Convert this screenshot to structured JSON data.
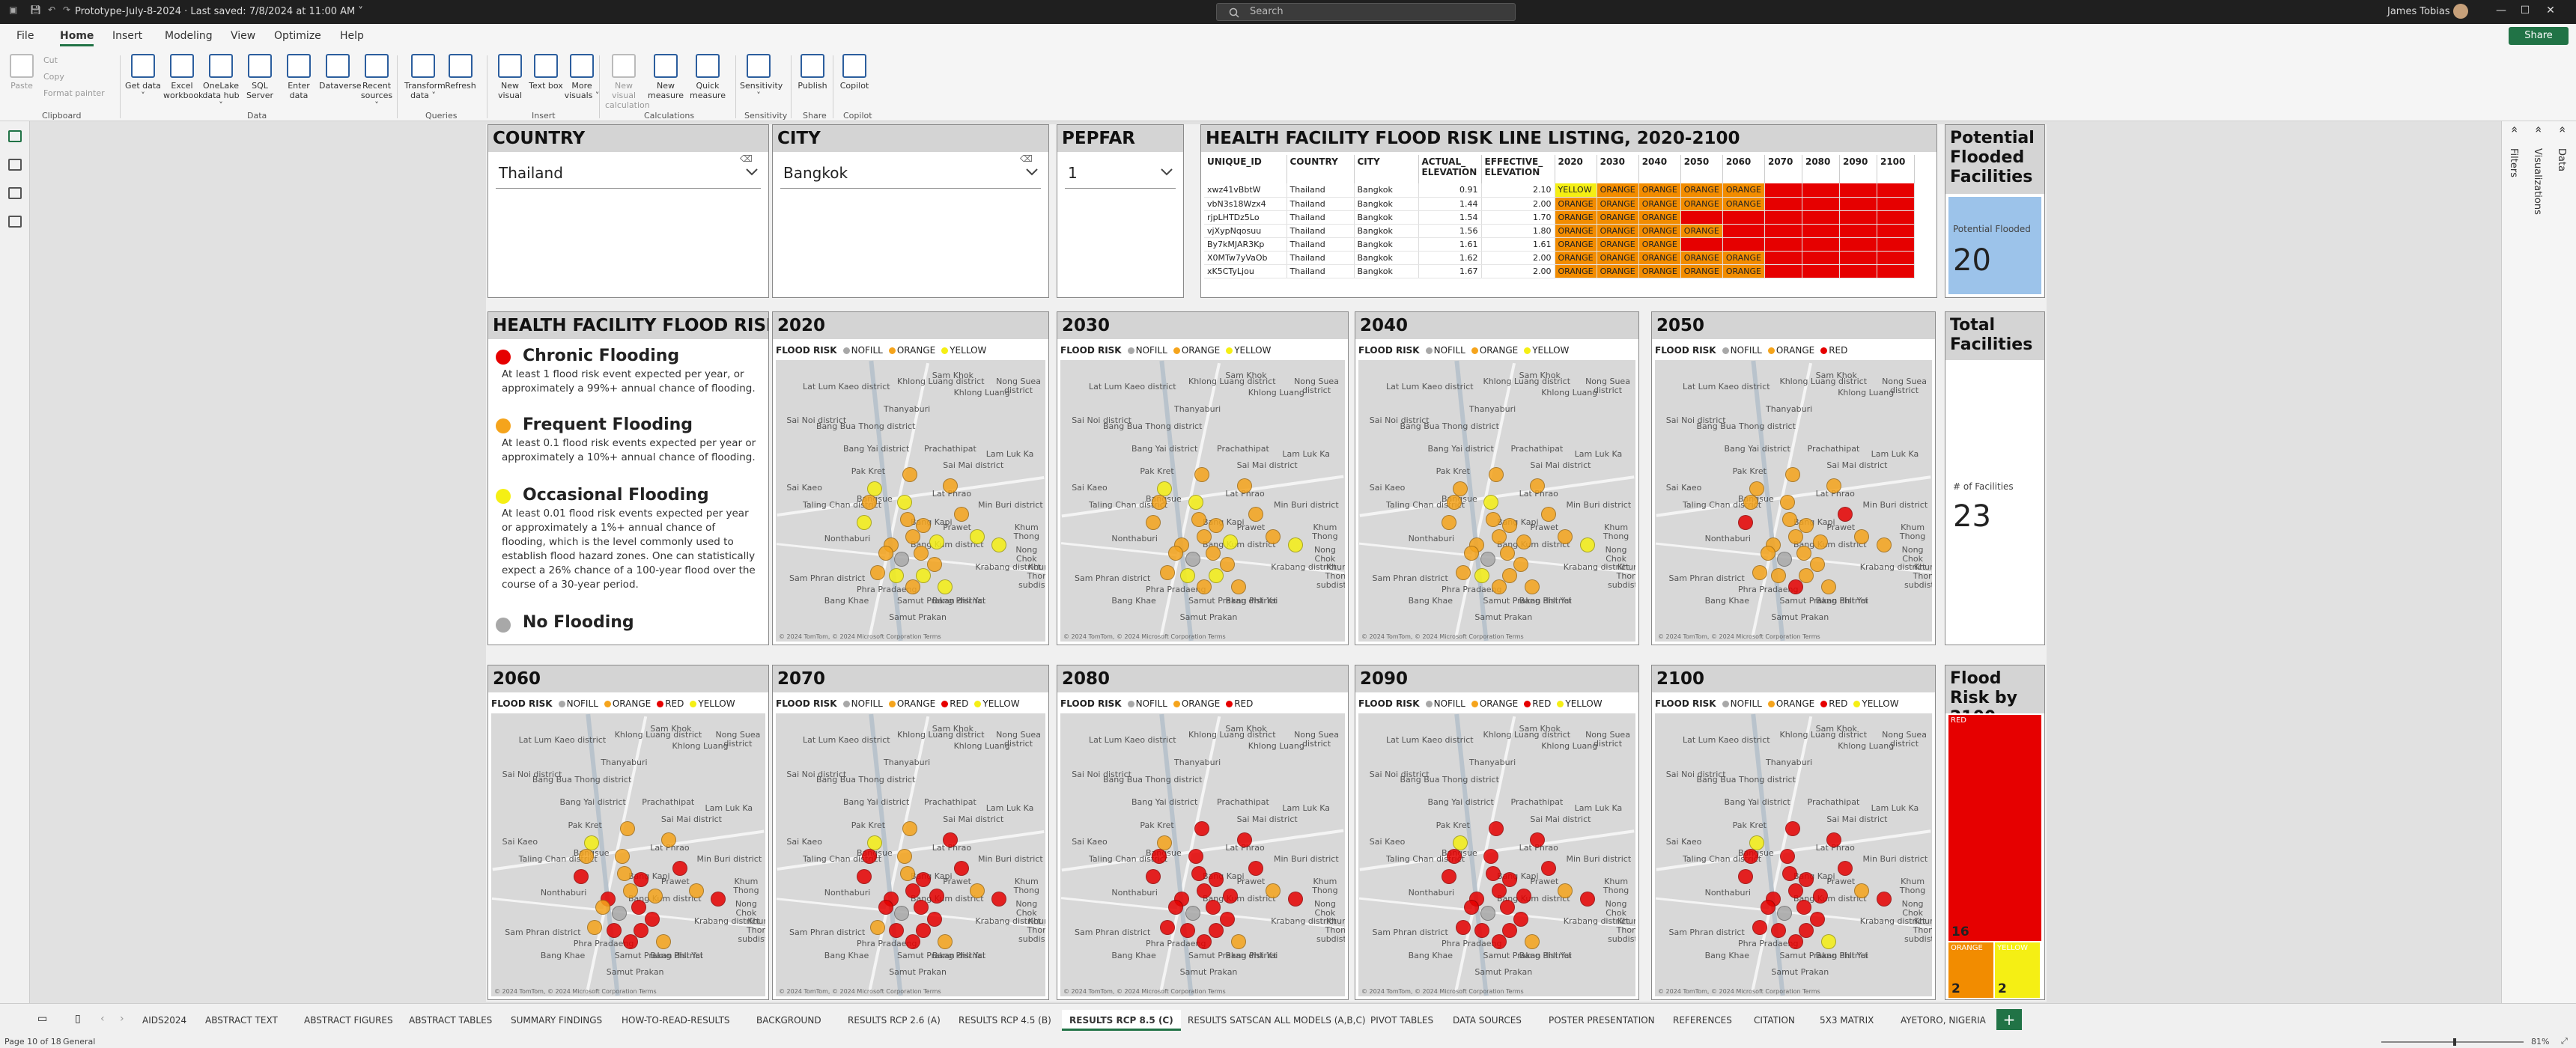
{
  "window": {
    "doc_title": "Prototype-July-8-2024 · Last saved: 7/8/2024 at 11:00 AM ˅",
    "search_placeholder": "Search",
    "user_name": "James Tobias"
  },
  "menu": {
    "tabs": [
      "File",
      "Home",
      "Insert",
      "Modeling",
      "View",
      "Optimize",
      "Help"
    ],
    "active": "Home",
    "share_label": "Share"
  },
  "ribbon": {
    "clipboard": {
      "paste": "Paste",
      "cut": "Cut",
      "copy": "Copy",
      "format_painter": "Format painter",
      "group": "Clipboard"
    },
    "data": {
      "buttons": [
        "Get data ˅",
        "Excel workbook",
        "OneLake data hub ˅",
        "SQL Server",
        "Enter data",
        "Dataverse",
        "Recent sources ˅"
      ],
      "group": "Data"
    },
    "queries": {
      "buttons": [
        "Transform data ˅",
        "Refresh"
      ],
      "group": "Queries"
    },
    "insert": {
      "buttons": [
        "New visual",
        "Text box",
        "More visuals ˅"
      ],
      "group": "Insert"
    },
    "calculations": {
      "buttons": [
        "New visual calculation",
        "New measure",
        "Quick measure"
      ],
      "group": "Calculations"
    },
    "sensitivity": {
      "buttons": [
        "Sensitivity ˅"
      ],
      "group": "Sensitivity"
    },
    "share": {
      "buttons": [
        "Publish"
      ],
      "group": "Share"
    },
    "copilot": {
      "buttons": [
        "Copilot"
      ],
      "group": "Copilot"
    }
  },
  "panes": {
    "filters": "Filters",
    "visualizations": "Visualizations",
    "data": "Data"
  },
  "slicers": {
    "country": {
      "title": "COUNTRY",
      "value": "Thailand"
    },
    "city": {
      "title": "CITY",
      "value": "Bangkok"
    },
    "pepfar": {
      "title": "PEPFAR",
      "value": "1"
    }
  },
  "listing": {
    "title": "HEALTH FACILITY FLOOD RISK LINE LISTING, 2020-2100",
    "columns": [
      "UNIQUE_ID",
      "COUNTRY",
      "CITY",
      "ACTUAL_ ELEVATION",
      "EFFECTIVE_ ELEVATION",
      "2020",
      "2030",
      "2040",
      "2050",
      "2060",
      "2070",
      "2080",
      "2090",
      "2100"
    ],
    "rows": [
      [
        "xwz41vBbtW",
        "Thailand",
        "Bangkok",
        "0.91",
        "2.10",
        "YELLOW",
        "ORANGE",
        "ORANGE",
        "ORANGE",
        "ORANGE",
        "RED",
        "RED",
        "RED",
        "RED"
      ],
      [
        "vbN3s18Wzx4",
        "Thailand",
        "Bangkok",
        "1.44",
        "2.00",
        "ORANGE",
        "ORANGE",
        "ORANGE",
        "ORANGE",
        "ORANGE",
        "RED",
        "RED",
        "RED",
        "RED"
      ],
      [
        "rjpLHTDz5Lo",
        "Thailand",
        "Bangkok",
        "1.54",
        "1.70",
        "ORANGE",
        "ORANGE",
        "ORANGE",
        "RED",
        "RED",
        "RED",
        "RED",
        "RED",
        "RED"
      ],
      [
        "vjXypNqosuu",
        "Thailand",
        "Bangkok",
        "1.56",
        "1.80",
        "ORANGE",
        "ORANGE",
        "ORANGE",
        "ORANGE",
        "RED",
        "RED",
        "RED",
        "RED",
        "RED"
      ],
      [
        "By7kMJAR3Kp",
        "Thailand",
        "Bangkok",
        "1.61",
        "1.61",
        "ORANGE",
        "ORANGE",
        "ORANGE",
        "RED",
        "RED",
        "RED",
        "RED",
        "RED",
        "RED"
      ],
      [
        "X0MTw7yVaOb",
        "Thailand",
        "Bangkok",
        "1.62",
        "2.00",
        "ORANGE",
        "ORANGE",
        "ORANGE",
        "ORANGE",
        "ORANGE",
        "RED",
        "RED",
        "RED",
        "RED"
      ],
      [
        "xK5CTyLjou",
        "Thailand",
        "Bangkok",
        "1.67",
        "2.00",
        "ORANGE",
        "ORANGE",
        "ORANGE",
        "ORANGE",
        "ORANGE",
        "RED",
        "RED",
        "RED",
        "RED"
      ]
    ]
  },
  "kpi_potential": {
    "title": "Potential Flooded Facilities ...",
    "label": "Potential Flooded",
    "value": "20"
  },
  "kpi_total": {
    "title": "Total Facilities",
    "label": "# of Facilities",
    "value": "23"
  },
  "flood_legend": {
    "title": "HEALTH FACILITY FLOOD RISK",
    "entries": [
      {
        "label": "Chronic Flooding",
        "color": "#e60000",
        "desc": "At least 1 flood risk event expected per year, or approximately a 99%+ annual chance of flooding."
      },
      {
        "label": "Frequent Flooding",
        "color": "#f5a41c",
        "desc": "At least 0.1 flood risk events expected per year or approximately a 10%+ annual chance of flooding."
      },
      {
        "label": "Occasional Flooding",
        "color": "#f5ef14",
        "desc": "At least 0.01 flood risk events expected per year or approximately a 1%+ annual chance of flooding, which is the level commonly used to establish flood hazard zones. One can statistically expect a 26% chance of a 100-year flood over the course of a 30-year period."
      },
      {
        "label": "No Flooding",
        "color": "#a8a8a8",
        "desc": ""
      }
    ]
  },
  "map_places": [
    "Lat Lum Kaeo district",
    "Khlong Luang district",
    "Nong Suea district",
    "Sai Noi district",
    "Thanyaburi",
    "Bang Bua Thong district",
    "Pak Kret",
    "Prachathipat",
    "Lam Luk Ka",
    "Sai Mai district",
    "Min Buri district",
    "Taling Chan district",
    "Bangsue",
    "Bang Kapi",
    "Khum Thong",
    "Nong Chok",
    "Sam Phran district",
    "Bang Phli Yai",
    "Samut Prakan",
    "Krabang district",
    "Khum Thong subdistrict",
    "Sam Khok",
    "Bang Yai district",
    "Sai Kaeo",
    "Samut Prakan district",
    "Khlong Luang",
    "Nonthaburi",
    "Bang Khae",
    "Phra Pradaeng",
    "Bang Kum district",
    "Prawet",
    "Lat Phrao"
  ],
  "map_attribution": "© 2024 TomTom, © 2024 Microsoft Corporation  Terms",
  "maps": [
    {
      "year": "2020",
      "legend": [
        {
          "label": "NOFILL",
          "color": "#a8a8a8"
        },
        {
          "label": "ORANGE",
          "color": "#f5a41c"
        },
        {
          "label": "YELLOW",
          "color": "#f5ef14"
        }
      ],
      "dots": [
        "#f5a41c",
        "#f5a41c",
        "#f5ef14",
        "#f5a41c",
        "#f5a41c",
        "#f5ef14",
        "#f5ef14",
        "#f5a41c",
        "#f5ef14",
        "#f5a41c",
        "#f5ef14",
        "#f5a41c",
        "#f5a41c",
        "#a8a8a8",
        "#f5a41c",
        "#f5a41c",
        "#f5ef14",
        "#f5a41c",
        "#f5ef14",
        "#f5ef14",
        "#f5a41c",
        "#f5ef14",
        "#f5a41c"
      ]
    },
    {
      "year": "2030",
      "legend": [
        {
          "label": "NOFILL",
          "color": "#a8a8a8"
        },
        {
          "label": "ORANGE",
          "color": "#f5a41c"
        },
        {
          "label": "YELLOW",
          "color": "#f5ef14"
        }
      ],
      "dots": [
        "#f5a41c",
        "#f5a41c",
        "#f5ef14",
        "#f5a41c",
        "#f5a41c",
        "#f5a41c",
        "#f5ef14",
        "#f5a41c",
        "#f5ef14",
        "#f5a41c",
        "#f5a41c",
        "#f5a41c",
        "#f5a41c",
        "#a8a8a8",
        "#f5a41c",
        "#f5a41c",
        "#f5ef14",
        "#f5a41c",
        "#f5a41c",
        "#f5ef14",
        "#f5a41c",
        "#f5ef14",
        "#f5a41c"
      ]
    },
    {
      "year": "2040",
      "legend": [
        {
          "label": "NOFILL",
          "color": "#a8a8a8"
        },
        {
          "label": "ORANGE",
          "color": "#f5a41c"
        },
        {
          "label": "YELLOW",
          "color": "#f5ef14"
        }
      ],
      "dots": [
        "#f5a41c",
        "#f5a41c",
        "#f5a41c",
        "#f5a41c",
        "#f5a41c",
        "#f5a41c",
        "#f5ef14",
        "#f5a41c",
        "#f5a41c",
        "#f5a41c",
        "#f5a41c",
        "#f5a41c",
        "#f5a41c",
        "#a8a8a8",
        "#f5a41c",
        "#f5a41c",
        "#f5ef14",
        "#f5a41c",
        "#f5a41c",
        "#f5ef14",
        "#f5a41c",
        "#f5a41c",
        "#f5a41c"
      ]
    },
    {
      "year": "2050",
      "legend": [
        {
          "label": "NOFILL",
          "color": "#a8a8a8"
        },
        {
          "label": "ORANGE",
          "color": "#f5a41c"
        },
        {
          "label": "RED",
          "color": "#e60000"
        }
      ],
      "dots": [
        "#f5a41c",
        "#f5a41c",
        "#f5a41c",
        "#f5a41c",
        "#f5a41c",
        "#e60000",
        "#f5a41c",
        "#f5a41c",
        "#f5a41c",
        "#e60000",
        "#f5a41c",
        "#f5a41c",
        "#f5a41c",
        "#a8a8a8",
        "#f5a41c",
        "#f5a41c",
        "#f5a41c",
        "#e60000",
        "#f5a41c",
        "#f5a41c",
        "#f5a41c",
        "#f5a41c",
        "#f5a41c"
      ]
    },
    {
      "year": "2060",
      "legend": [
        {
          "label": "NOFILL",
          "color": "#a8a8a8"
        },
        {
          "label": "ORANGE",
          "color": "#f5a41c"
        },
        {
          "label": "RED",
          "color": "#e60000"
        },
        {
          "label": "YELLOW",
          "color": "#f5ef14"
        }
      ],
      "dots": [
        "#f5a41c",
        "#f5a41c",
        "#f5ef14",
        "#e60000",
        "#f5a41c",
        "#e60000",
        "#f5a41c",
        "#e60000",
        "#f5a41c",
        "#e60000",
        "#f5a41c",
        "#e60000",
        "#f5a41c",
        "#a8a8a8",
        "#e60000",
        "#f5a41c",
        "#e60000",
        "#e60000",
        "#f5a41c",
        "#e60000",
        "#f5a41c",
        "#e60000",
        "#f5a41c"
      ]
    },
    {
      "year": "2070",
      "legend": [
        {
          "label": "NOFILL",
          "color": "#a8a8a8"
        },
        {
          "label": "ORANGE",
          "color": "#f5a41c"
        },
        {
          "label": "RED",
          "color": "#e60000"
        },
        {
          "label": "YELLOW",
          "color": "#f5ef14"
        }
      ],
      "dots": [
        "#e60000",
        "#f5a41c",
        "#f5ef14",
        "#e60000",
        "#e60000",
        "#e60000",
        "#f5a41c",
        "#e60000",
        "#e60000",
        "#e60000",
        "#f5a41c",
        "#e60000",
        "#e60000",
        "#a8a8a8",
        "#e60000",
        "#f5a41c",
        "#e60000",
        "#e60000",
        "#f5a41c",
        "#e60000",
        "#e60000",
        "#e60000",
        "#f5a41c"
      ]
    },
    {
      "year": "2080",
      "legend": [
        {
          "label": "NOFILL",
          "color": "#a8a8a8"
        },
        {
          "label": "ORANGE",
          "color": "#f5a41c"
        },
        {
          "label": "RED",
          "color": "#e60000"
        }
      ],
      "dots": [
        "#e60000",
        "#e60000",
        "#f5a41c",
        "#e60000",
        "#e60000",
        "#e60000",
        "#e60000",
        "#e60000",
        "#e60000",
        "#e60000",
        "#f5a41c",
        "#e60000",
        "#e60000",
        "#a8a8a8",
        "#e60000",
        "#e60000",
        "#e60000",
        "#e60000",
        "#f5a41c",
        "#e60000",
        "#e60000",
        "#e60000",
        "#e60000"
      ]
    },
    {
      "year": "2090",
      "legend": [
        {
          "label": "NOFILL",
          "color": "#a8a8a8"
        },
        {
          "label": "ORANGE",
          "color": "#f5a41c"
        },
        {
          "label": "RED",
          "color": "#e60000"
        },
        {
          "label": "YELLOW",
          "color": "#f5ef14"
        }
      ],
      "dots": [
        "#e60000",
        "#e60000",
        "#f5ef14",
        "#e60000",
        "#e60000",
        "#e60000",
        "#e60000",
        "#e60000",
        "#e60000",
        "#e60000",
        "#f5a41c",
        "#e60000",
        "#e60000",
        "#a8a8a8",
        "#e60000",
        "#e60000",
        "#e60000",
        "#e60000",
        "#f5a41c",
        "#e60000",
        "#e60000",
        "#e60000",
        "#e60000"
      ]
    },
    {
      "year": "2100",
      "legend": [
        {
          "label": "NOFILL",
          "color": "#a8a8a8"
        },
        {
          "label": "ORANGE",
          "color": "#f5a41c"
        },
        {
          "label": "RED",
          "color": "#e60000"
        },
        {
          "label": "YELLOW",
          "color": "#f5ef14"
        }
      ],
      "dots": [
        "#e60000",
        "#e60000",
        "#f5ef14",
        "#e60000",
        "#e60000",
        "#e60000",
        "#e60000",
        "#e60000",
        "#e60000",
        "#e60000",
        "#f5a41c",
        "#e60000",
        "#e60000",
        "#a8a8a8",
        "#e60000",
        "#e60000",
        "#e60000",
        "#e60000",
        "#f5ef14",
        "#e60000",
        "#e60000",
        "#e60000",
        "#e60000"
      ]
    }
  ],
  "flood_risk_2100": {
    "title": "Flood Risk by 2100",
    "segments": [
      {
        "label": "RED",
        "value": 16,
        "color": "#e60000"
      },
      {
        "label": "ORANGE",
        "value": 2,
        "color": "#f28c00"
      },
      {
        "label": "YELLOW",
        "value": 2,
        "color": "#f5ef14"
      }
    ]
  },
  "page_tabs": [
    "AIDS2024",
    "ABSTRACT TEXT",
    "ABSTRACT FIGURES",
    "ABSTRACT TABLES",
    "SUMMARY FINDINGS",
    "HOW-TO-READ-RESULTS",
    "BACKGROUND",
    "RESULTS RCP 2.6 (A)",
    "RESULTS RCP 4.5 (B)",
    "RESULTS RCP 8.5 (C)",
    "RESULTS SATSCAN ALL MODELS (A,B,C)",
    "PIVOT TABLES",
    "DATA SOURCES",
    "POSTER PRESENTATION",
    "REFERENCES",
    "CITATION",
    "5X3 MATRIX",
    "AYETORO, NIGERIA"
  ],
  "active_page_tab": "RESULTS RCP 8.5 (C)",
  "status": {
    "page": "Page 10 of 18",
    "sensitivity": "General",
    "zoom": "81%"
  }
}
